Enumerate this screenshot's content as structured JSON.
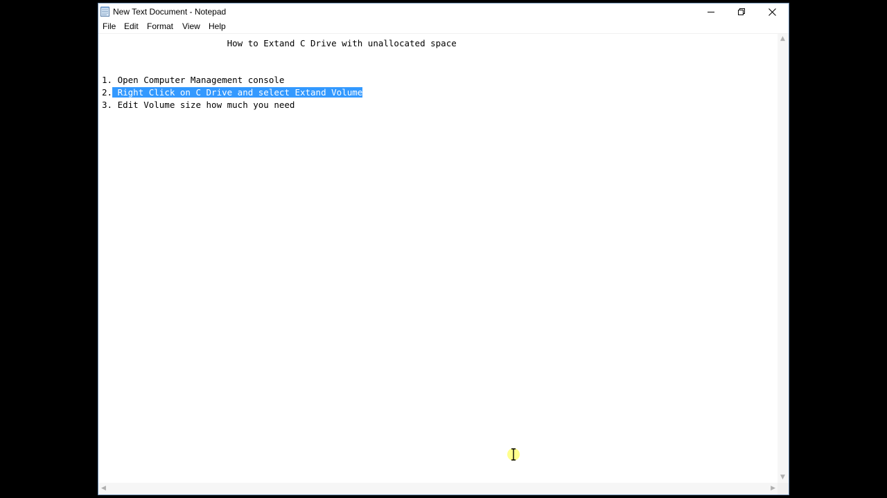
{
  "window": {
    "title": "New Text Document - Notepad"
  },
  "menu": {
    "items": [
      "File",
      "Edit",
      "Format",
      "View",
      "Help"
    ]
  },
  "editor": {
    "lines": [
      "                        How to Extand C Drive with unallocated space",
      "",
      "",
      "1. Open Computer Management console",
      "2.",
      "3. Edit Volume size how much you need"
    ],
    "selected_text": " Right Click on C Drive and select Extand Volume"
  },
  "colors": {
    "selection": "#3399ff",
    "cursor_highlight": "#ffff66"
  },
  "icons": {
    "app": "notepad-icon",
    "minimize": "minimize-icon",
    "restore": "restore-icon",
    "close": "close-icon",
    "text_cursor": "ibeam-cursor-icon"
  }
}
